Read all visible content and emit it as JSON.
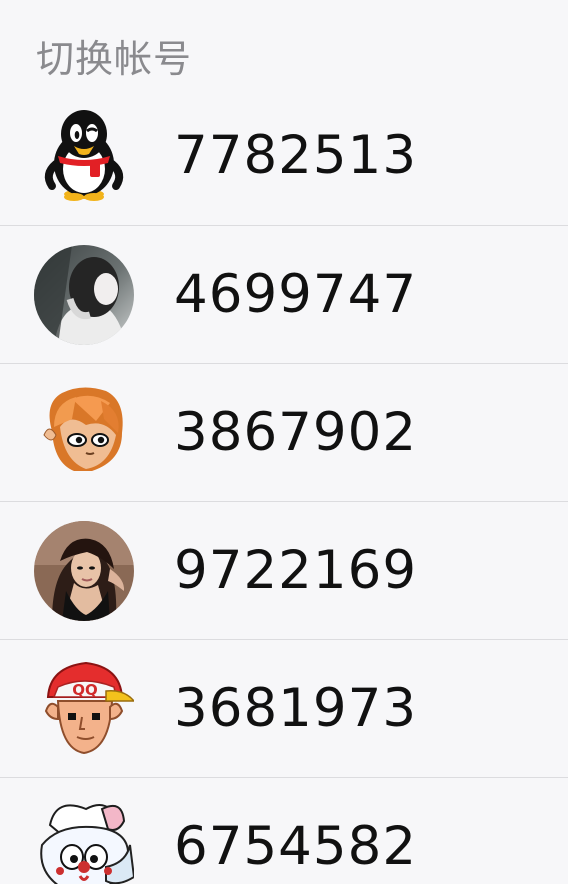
{
  "header": {
    "title": "切换帐号"
  },
  "accounts": [
    {
      "number": "7782513",
      "avatar_icon": "qq-penguin-icon"
    },
    {
      "number": "4699747",
      "avatar_icon": "person-photo-avatar"
    },
    {
      "number": "3867902",
      "avatar_icon": "cartoon-boy-avatar"
    },
    {
      "number": "9722169",
      "avatar_icon": "woman-photo-avatar"
    },
    {
      "number": "3681973",
      "avatar_icon": "cartoon-cap-qq-avatar"
    },
    {
      "number": "6754582",
      "avatar_icon": "cartoon-rabbit-avatar"
    }
  ],
  "colors": {
    "background": "#f7f7f9",
    "header_text": "#8a8a8e",
    "divider": "#dcdcdf",
    "number_text": "#111111"
  },
  "cap_text": "QQ"
}
